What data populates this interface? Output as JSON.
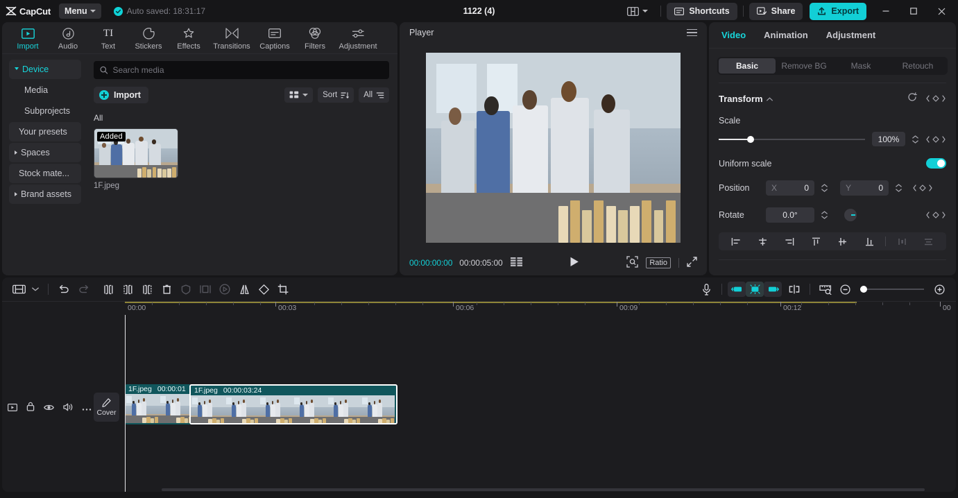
{
  "titlebar": {
    "app_name": "CapCut",
    "menu_label": "Menu",
    "autosave_text": "Auto saved: 18:31:17",
    "project_title": "1122 (4)",
    "shortcuts_label": "Shortcuts",
    "share_label": "Share",
    "export_label": "Export",
    "accent_color": "#12cfd6"
  },
  "toolstrip": {
    "items": [
      {
        "label": "Import",
        "icon": "import-icon",
        "active": true
      },
      {
        "label": "Audio",
        "icon": "audio-note-icon",
        "active": false
      },
      {
        "label": "Text",
        "icon": "text-ti-icon",
        "active": false
      },
      {
        "label": "Stickers",
        "icon": "sticker-icon",
        "active": false
      },
      {
        "label": "Effects",
        "icon": "effects-sparkle-icon",
        "active": false
      },
      {
        "label": "Transitions",
        "icon": "transitions-icon",
        "active": false
      },
      {
        "label": "Captions",
        "icon": "captions-icon",
        "active": false
      },
      {
        "label": "Filters",
        "icon": "filters-circles-icon",
        "active": false
      },
      {
        "label": "Adjustment",
        "icon": "adjustment-sliders-icon",
        "active": false
      }
    ]
  },
  "sidebar": {
    "items": [
      {
        "label": "Device",
        "expandable": true,
        "selected": true
      },
      {
        "label": "Media",
        "expandable": false,
        "selected": false
      },
      {
        "label": "Subprojects",
        "expandable": false,
        "selected": false
      },
      {
        "label": "Your presets",
        "expandable": false,
        "selected": false
      },
      {
        "label": "Spaces",
        "expandable": true,
        "selected": false
      },
      {
        "label": "Stock mate...",
        "expandable": false,
        "selected": false
      },
      {
        "label": "Brand assets",
        "expandable": true,
        "selected": false
      }
    ]
  },
  "media_panel": {
    "search_placeholder": "Search media",
    "search_value": "",
    "import_label": "Import",
    "grid_view_label": "",
    "sort_label": "Sort",
    "filter_label": "All",
    "section_label": "All",
    "items": [
      {
        "name": "1F.jpeg",
        "badge": "Added"
      }
    ]
  },
  "player": {
    "title": "Player",
    "current_time": "00:00:00:00",
    "total_time": "00:00:05:00",
    "ratio_label": "Ratio",
    "play_icon": "play-icon",
    "fullscreen_icon": "fullscreen-icon",
    "snapshot_icon": "snapshot-icon",
    "quality_icon": "quality-icon"
  },
  "inspector": {
    "tabs": [
      {
        "label": "Video",
        "active": true
      },
      {
        "label": "Animation",
        "active": false
      },
      {
        "label": "Adjustment",
        "active": false
      }
    ],
    "segments": [
      {
        "label": "Basic",
        "active": true,
        "enabled": true
      },
      {
        "label": "Remove BG",
        "active": false,
        "enabled": false
      },
      {
        "label": "Mask",
        "active": false,
        "enabled": false
      },
      {
        "label": "Retouch",
        "active": false,
        "enabled": false
      }
    ],
    "transform": {
      "title": "Transform",
      "scale_label": "Scale",
      "scale_value": "100%",
      "uniform_scale_label": "Uniform scale",
      "uniform_scale_on": true,
      "position_label": "Position",
      "position_x_axis": "X",
      "position_x": "0",
      "position_y_axis": "Y",
      "position_y": "0",
      "rotate_label": "Rotate",
      "rotate_value": "0.0°"
    },
    "align_icons": [
      "align-left-icon",
      "align-center-horizontal-icon",
      "align-right-icon",
      "align-top-icon",
      "align-middle-vertical-icon",
      "align-bottom-icon",
      "distribute-horizontal-icon",
      "distribute-vertical-icon"
    ]
  },
  "timeline": {
    "toolbar_left": [
      "track-layout-icon",
      "undo-icon",
      "redo-icon",
      "split-icon",
      "trim-start-icon",
      "trim-end-icon",
      "delete-icon",
      "freeze-icon",
      "picture-in-picture-icon",
      "reverse-icon",
      "mirror-icon",
      "rotate-icon",
      "crop-icon"
    ],
    "toolbar_right": [
      "microphone-icon",
      "ripple-left-icon",
      "auto-adjust-icon",
      "ripple-right-icon",
      "keyframe-split-icon",
      "ruler-zoom-icon",
      "zoom-out-icon",
      "zoom-in-icon"
    ],
    "ruler_labels": [
      "00:00",
      "00:03",
      "00:06",
      "00:09",
      "00:12",
      "00"
    ],
    "track_header_icons": [
      "track-type-icon",
      "lock-icon",
      "eye-icon",
      "volume-icon",
      "more-icon"
    ],
    "cover_label": "Cover",
    "clips": [
      {
        "name": "1F.jpeg",
        "duration": "00:00:01",
        "selected": false
      },
      {
        "name": "1F.jpeg",
        "duration": "00:00:03:24",
        "selected": true
      }
    ]
  }
}
